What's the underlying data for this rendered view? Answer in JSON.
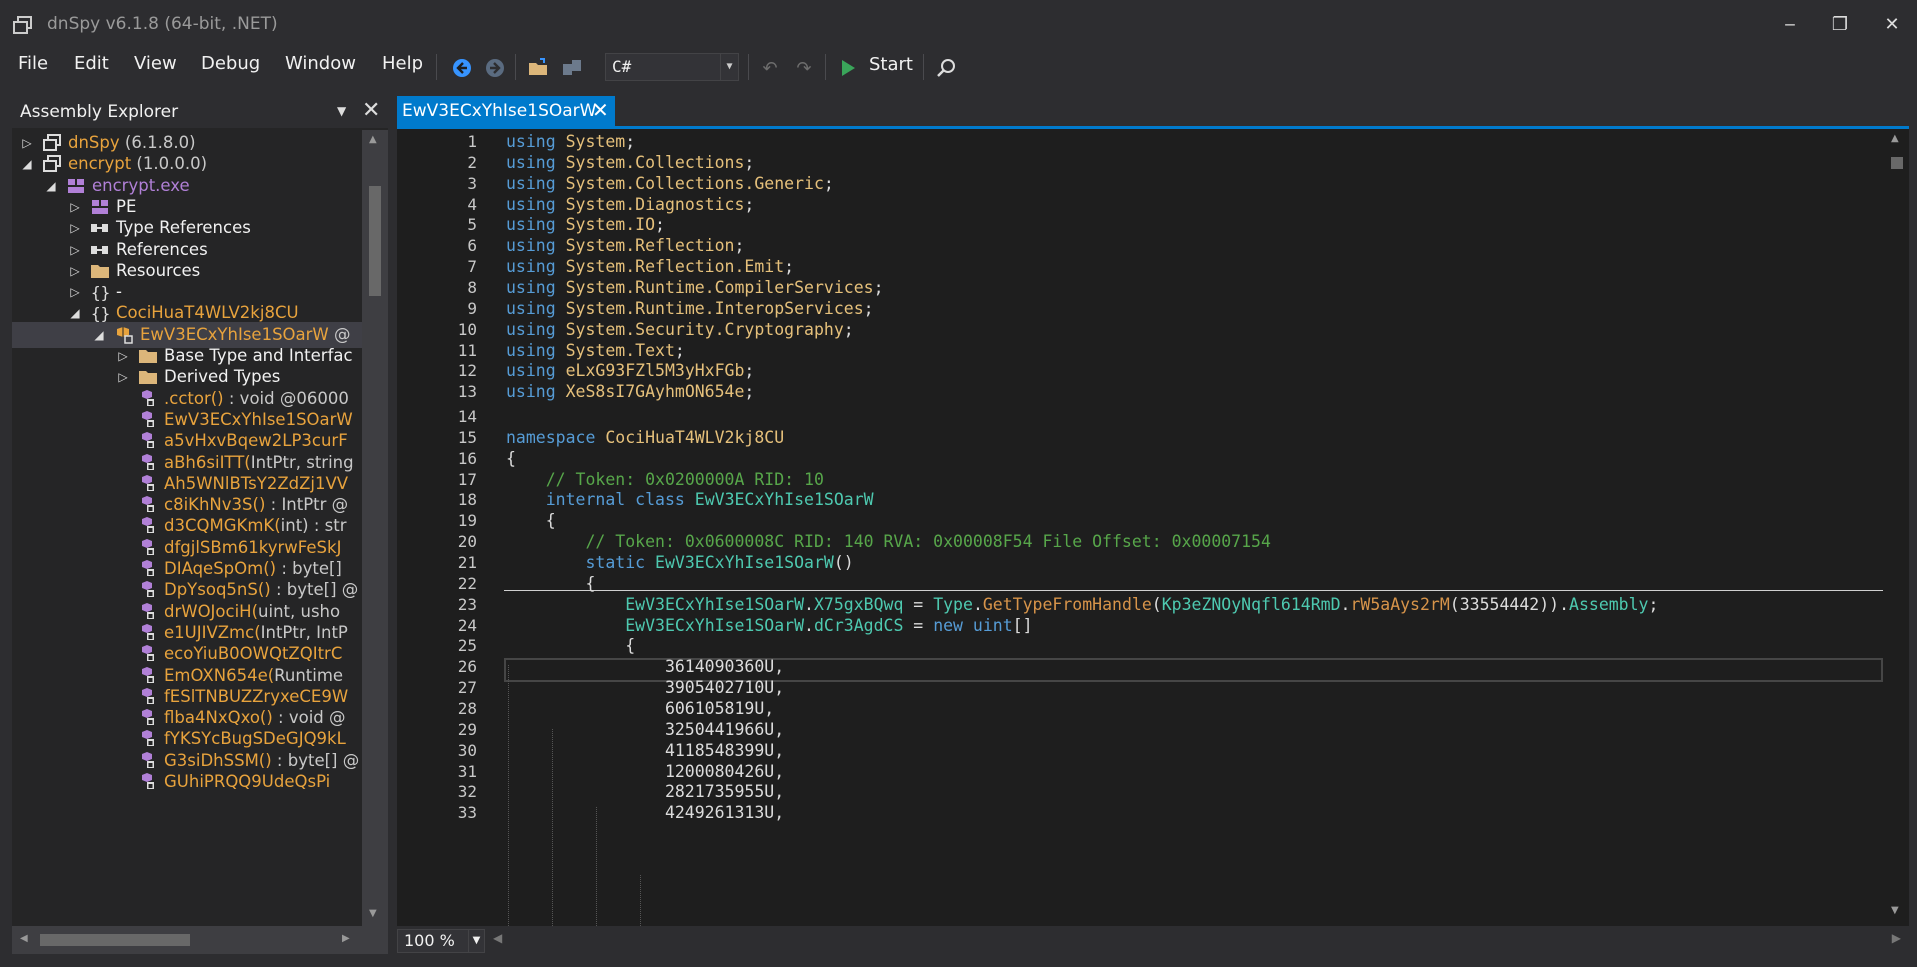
{
  "window": {
    "title": "dnSpy v6.1.8 (64-bit, .NET)",
    "minimize": "‒",
    "maximize": "❐",
    "close": "✕"
  },
  "menu": [
    "File",
    "Edit",
    "View",
    "Debug",
    "Window",
    "Help"
  ],
  "toolbar": {
    "language": "C#",
    "start_label": "Start"
  },
  "explorer": {
    "title": "Assembly Explorer",
    "tree": [
      {
        "label": "dnSpy",
        "suffix": " (6.1.8.0)",
        "color": "#e8a33d",
        "icon": "assembly-icon",
        "arrow": "▷",
        "indent": 0
      },
      {
        "label": "encrypt",
        "suffix": " (1.0.0.0)",
        "color": "#e8a33d",
        "icon": "assembly-icon",
        "arrow": "◢",
        "indent": 0
      },
      {
        "label": "encrypt.exe",
        "suffix": "",
        "color": "#b180d7",
        "icon": "module-icon",
        "arrow": "◢",
        "indent": 1
      },
      {
        "label": "PE",
        "suffix": "",
        "color": "#f1f1f1",
        "icon": "pe-icon",
        "arrow": "▷",
        "indent": 2
      },
      {
        "label": "Type References",
        "suffix": "",
        "color": "#f1f1f1",
        "icon": "typeref-icon",
        "arrow": "▷",
        "indent": 2
      },
      {
        "label": "References",
        "suffix": "",
        "color": "#f1f1f1",
        "icon": "reference-icon",
        "arrow": "▷",
        "indent": 2
      },
      {
        "label": "Resources",
        "suffix": "",
        "color": "#f1f1f1",
        "icon": "folder-icon",
        "arrow": "▷",
        "indent": 2
      },
      {
        "label": "-",
        "suffix": "",
        "color": "#f1f1f1",
        "icon": "namespace-icon",
        "arrow": "▷",
        "indent": 2
      },
      {
        "label": "CociHuaT4WLV2kj8CU",
        "suffix": "",
        "color": "#e8a33d",
        "icon": "namespace-icon",
        "arrow": "◢",
        "indent": 2
      },
      {
        "label": "EwV3ECxYhIse1SOarW",
        "suffix": " @",
        "color": "#e8a33d",
        "icon": "class-icon",
        "arrow": "◢",
        "indent": 3,
        "selected": true
      },
      {
        "label": "Base Type and Interfac",
        "suffix": "",
        "color": "#f1f1f1",
        "icon": "folder-icon",
        "arrow": "▷",
        "indent": 4
      },
      {
        "label": "Derived Types",
        "suffix": "",
        "color": "#f1f1f1",
        "icon": "folder-icon",
        "arrow": "▷",
        "indent": 4
      },
      {
        "label": ".cctor()",
        "suffix": " : void @06000",
        "color": "#e8a33d",
        "icon": "method-icon",
        "arrow": "",
        "indent": 4
      },
      {
        "label": "EwV3ECxYhIse1SOarW",
        "suffix": "",
        "color": "#e8a33d",
        "icon": "method-icon",
        "arrow": "",
        "indent": 4
      },
      {
        "label": "a5vHxvBqew2LP3curF",
        "suffix": "",
        "color": "#e8a33d",
        "icon": "method-icon",
        "arrow": "",
        "indent": 4
      },
      {
        "label": "aBh6siITT(",
        "suffix": "IntPtr, string",
        "color": "#e8a33d",
        "icon": "method-icon",
        "arrow": "",
        "indent": 4
      },
      {
        "label": "Ah5WNlBTsY2ZdZj1VV",
        "suffix": "",
        "color": "#e8a33d",
        "icon": "method-icon",
        "arrow": "",
        "indent": 4
      },
      {
        "label": "c8iKhNv3S()",
        "suffix": " : IntPtr @",
        "color": "#e8a33d",
        "icon": "method-icon",
        "arrow": "",
        "indent": 4
      },
      {
        "label": "d3CQMGKmK(",
        "suffix": "int) : str",
        "color": "#e8a33d",
        "icon": "method-icon",
        "arrow": "",
        "indent": 4
      },
      {
        "label": "dfgjlSBm61kyrwFeSkJ",
        "suffix": "",
        "color": "#e8a33d",
        "icon": "method-icon",
        "arrow": "",
        "indent": 4
      },
      {
        "label": "DIAqeSpOm()",
        "suffix": " : byte[]",
        "color": "#e8a33d",
        "icon": "method-icon",
        "arrow": "",
        "indent": 4
      },
      {
        "label": "DpYsoq5nS()",
        "suffix": " : byte[] @",
        "color": "#e8a33d",
        "icon": "method-icon",
        "arrow": "",
        "indent": 4
      },
      {
        "label": "drWOJociH(",
        "suffix": "uint, usho",
        "color": "#e8a33d",
        "icon": "method-icon",
        "arrow": "",
        "indent": 4
      },
      {
        "label": "e1UJIVZmc(",
        "suffix": "IntPtr, IntP",
        "color": "#e8a33d",
        "icon": "method-icon",
        "arrow": "",
        "indent": 4
      },
      {
        "label": "ecoYiuB0OWQtZQItrC",
        "suffix": "",
        "color": "#e8a33d",
        "icon": "method-icon",
        "arrow": "",
        "indent": 4
      },
      {
        "label": "EmOXN654e(",
        "suffix": "Runtime",
        "color": "#e8a33d",
        "icon": "method-icon",
        "arrow": "",
        "indent": 4
      },
      {
        "label": "fESlTNBUZZryxeCE9W",
        "suffix": "",
        "color": "#e8a33d",
        "icon": "method-icon",
        "arrow": "",
        "indent": 4
      },
      {
        "label": "flba4NxQxo()",
        "suffix": " : void @",
        "color": "#e8a33d",
        "icon": "method-icon",
        "arrow": "",
        "indent": 4
      },
      {
        "label": "fYKSYcBugSDeGJQ9kL",
        "suffix": "",
        "color": "#e8a33d",
        "icon": "method-icon",
        "arrow": "",
        "indent": 4
      },
      {
        "label": "G3siDhSSM()",
        "suffix": " : byte[] @",
        "color": "#e8a33d",
        "icon": "method-icon",
        "arrow": "",
        "indent": 4
      },
      {
        "label": "GUhiPRQQ9UdeQsPi",
        "suffix": "",
        "color": "#e8a33d",
        "icon": "method-icon",
        "arrow": "",
        "indent": 4
      }
    ]
  },
  "editor": {
    "tab_label": "EwV3ECxYhIse1SOarW",
    "zoom": "100 %",
    "lines": [
      {
        "n": "1",
        "t": [
          [
            "kw",
            "using "
          ],
          [
            "ns",
            "System"
          ],
          [
            "",
            "; "
          ]
        ]
      },
      {
        "n": "2",
        "t": [
          [
            "kw",
            "using "
          ],
          [
            "ns",
            "System.Collections"
          ],
          [
            "",
            ";"
          ]
        ]
      },
      {
        "n": "3",
        "t": [
          [
            "kw",
            "using "
          ],
          [
            "ns",
            "System.Collections.Generic"
          ],
          [
            "",
            ";"
          ]
        ]
      },
      {
        "n": "4",
        "t": [
          [
            "kw",
            "using "
          ],
          [
            "ns",
            "System.Diagnostics"
          ],
          [
            "",
            ";"
          ]
        ]
      },
      {
        "n": "5",
        "t": [
          [
            "kw",
            "using "
          ],
          [
            "ns",
            "System.IO"
          ],
          [
            "",
            ";"
          ]
        ]
      },
      {
        "n": "6",
        "t": [
          [
            "kw",
            "using "
          ],
          [
            "ns",
            "System.Reflection"
          ],
          [
            "",
            ";"
          ]
        ]
      },
      {
        "n": "7",
        "t": [
          [
            "kw",
            "using "
          ],
          [
            "ns",
            "System.Reflection.Emit"
          ],
          [
            "",
            ";"
          ]
        ]
      },
      {
        "n": "8",
        "t": [
          [
            "kw",
            "using "
          ],
          [
            "ns",
            "System.Runtime.CompilerServices"
          ],
          [
            "",
            ";"
          ]
        ]
      },
      {
        "n": "9",
        "t": [
          [
            "kw",
            "using "
          ],
          [
            "ns",
            "System.Runtime.InteropServices"
          ],
          [
            "",
            ";"
          ]
        ]
      },
      {
        "n": "10",
        "t": [
          [
            "kw",
            "using "
          ],
          [
            "ns",
            "System.Security.Cryptography"
          ],
          [
            "",
            ";"
          ]
        ]
      },
      {
        "n": "11",
        "t": [
          [
            "kw",
            "using "
          ],
          [
            "ns",
            "System.Text"
          ],
          [
            "",
            ";"
          ]
        ]
      },
      {
        "n": "12",
        "t": [
          [
            "kw",
            "using "
          ],
          [
            "ns",
            "eLxG93FZl5M3yHxFGb"
          ],
          [
            "",
            ";"
          ]
        ]
      },
      {
        "n": "13",
        "t": [
          [
            "kw",
            "using "
          ],
          [
            "ns",
            "XeS8sI7GAyhmON654e"
          ],
          [
            "",
            ";"
          ]
        ]
      },
      {
        "n": "14",
        "t": []
      },
      {
        "n": "15",
        "t": [
          [
            "kw",
            "namespace "
          ],
          [
            "ns",
            "CociHuaT4WLV2kj8CU"
          ]
        ]
      },
      {
        "n": "16",
        "t": [
          [
            "",
            "{"
          ]
        ]
      },
      {
        "n": "17",
        "t": [
          [
            "",
            "    "
          ],
          [
            "cm",
            "// Token: 0x0200000A RID: 10"
          ]
        ]
      },
      {
        "n": "18",
        "t": [
          [
            "",
            "    "
          ],
          [
            "kw",
            "internal class "
          ],
          [
            "ty",
            "EwV3ECxYhIse1SOarW"
          ]
        ]
      },
      {
        "n": "19",
        "t": [
          [
            "",
            "    {"
          ]
        ]
      },
      {
        "n": "20",
        "t": [
          [
            "",
            "        "
          ],
          [
            "cm",
            "// Token: 0x0600008C RID: 140 RVA: 0x00008F54 File Offset: 0x00007154"
          ]
        ]
      },
      {
        "n": "21",
        "t": [
          [
            "",
            "        "
          ],
          [
            "kw",
            "static "
          ],
          [
            "ty",
            "EwV3ECxYhIse1SOarW"
          ],
          [
            "",
            "()"
          ]
        ]
      },
      {
        "n": "22",
        "t": [
          [
            "",
            "        {"
          ]
        ]
      },
      {
        "n": "23",
        "t": [
          [
            "",
            "            "
          ],
          [
            "ty",
            "EwV3ECxYhIse1SOarW"
          ],
          [
            "",
            "."
          ],
          [
            "ty",
            "X75gxBQwq"
          ],
          [
            "",
            " = "
          ],
          [
            "ty",
            "Type"
          ],
          [
            "",
            "."
          ],
          [
            "mt",
            "GetTypeFromHandle"
          ],
          [
            "",
            "("
          ],
          [
            "ty",
            "Kp3eZNOyNqfl614RmD"
          ],
          [
            "",
            "."
          ],
          [
            "mt",
            "rW5aAys2rM"
          ],
          [
            "",
            "(33554442))."
          ],
          [
            "ty",
            "Assembly"
          ],
          [
            "",
            ";"
          ]
        ]
      },
      {
        "n": "24",
        "t": [
          [
            "",
            "            "
          ],
          [
            "ty",
            "EwV3ECxYhIse1SOarW"
          ],
          [
            "",
            "."
          ],
          [
            "ty",
            "dCr3AgdCS"
          ],
          [
            "",
            " = "
          ],
          [
            "kw",
            "new uint"
          ],
          [
            "",
            "[]"
          ]
        ]
      },
      {
        "n": "25",
        "t": [
          [
            "",
            "            {"
          ]
        ]
      },
      {
        "n": "26",
        "t": [
          [
            "",
            "                3614090360U,"
          ]
        ]
      },
      {
        "n": "27",
        "t": [
          [
            "",
            "                3905402710U,"
          ]
        ]
      },
      {
        "n": "28",
        "t": [
          [
            "",
            "                606105819U,"
          ]
        ]
      },
      {
        "n": "29",
        "t": [
          [
            "",
            "                3250441966U,"
          ]
        ]
      },
      {
        "n": "30",
        "t": [
          [
            "",
            "                4118548399U,"
          ]
        ]
      },
      {
        "n": "31",
        "t": [
          [
            "",
            "                1200080426U,"
          ]
        ]
      },
      {
        "n": "32",
        "t": [
          [
            "",
            "                2821735955U,"
          ]
        ]
      },
      {
        "n": "33",
        "t": [
          [
            "",
            "                4249261313U,"
          ]
        ]
      }
    ]
  }
}
